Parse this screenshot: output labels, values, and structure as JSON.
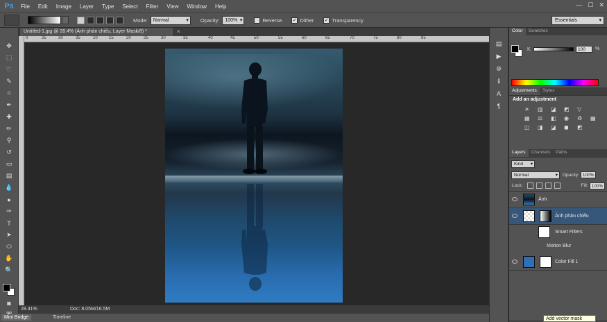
{
  "app": {
    "logo": "Ps"
  },
  "menu": [
    "File",
    "Edit",
    "Image",
    "Layer",
    "Type",
    "Select",
    "Filter",
    "View",
    "Window",
    "Help"
  ],
  "window_controls": [
    "—",
    "☐",
    "✕"
  ],
  "options": {
    "mode_label": "Mode:",
    "mode_value": "Normal",
    "opacity_label": "Opacity:",
    "opacity_value": "100%",
    "reverse_label": "Reverse",
    "dither_label": "Dither",
    "transparency_label": "Transparency",
    "workspace": "Essentials"
  },
  "document": {
    "tab_title": "Untitled-1.jpg @ 28.4% (Ảnh phản chiếu, Layer Mask/8) *",
    "close_glyph": "×",
    "ruler_ticks": [
      "0",
      "25",
      "30",
      "35",
      "10",
      "15",
      "20",
      "25",
      "30",
      "35",
      "40",
      "45",
      "50",
      "55",
      "60",
      "65",
      "70",
      "75",
      "80",
      "85"
    ],
    "zoom": "28.41%",
    "doc_info": "Doc: 8.05M/16.5M"
  },
  "bottom_tabs": [
    "Mini Bridge",
    "Timeline"
  ],
  "color_panel": {
    "tabs": [
      "Color",
      "Swatches"
    ],
    "channel": "K",
    "value": "100",
    "unit": "%"
  },
  "adjustments": {
    "tabs": [
      "Adjustments",
      "Styles"
    ],
    "title": "Add an adjustment"
  },
  "layers": {
    "tabs": [
      "Layers",
      "Channels",
      "Paths"
    ],
    "kind": "Kind",
    "blend_mode": "Normal",
    "opacity_label": "Opacity:",
    "opacity_value": "100%",
    "lock_label": "Lock:",
    "fill_label": "Fill:",
    "fill_value": "100%",
    "items": [
      {
        "name": "Ảnh"
      },
      {
        "name": "Ảnh phản chiếu"
      },
      {
        "name": "Smart Filters"
      },
      {
        "name": "Motion Blur"
      },
      {
        "name": "Color Fill 1"
      }
    ],
    "tooltip": "Add vector mask"
  },
  "colors": {
    "accent_blue": "#2f7cc2",
    "selected_layer": "#37577a"
  }
}
